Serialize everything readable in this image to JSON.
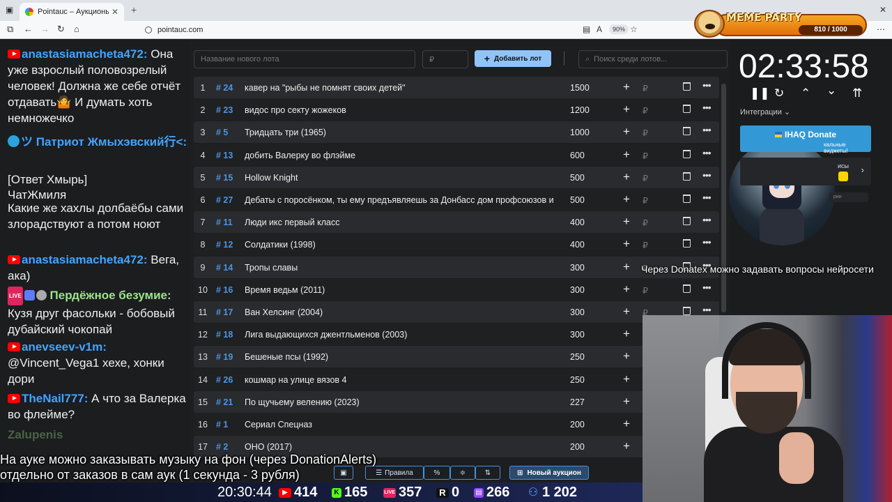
{
  "browser": {
    "tab_title": "Pointauc – Аукционы, лотереи",
    "tab_close": "✕",
    "new_tab": "+",
    "url": "pointauc.com",
    "zoom": "90%"
  },
  "meme_banner": {
    "title": "MEME PARTY",
    "count": "810 / 1000"
  },
  "chat": {
    "messages": [
      {
        "user": "anastasiamacheta472:",
        "text": " Она уже взрослый половозрелый человек! Должна же себе отчёт отдавать🤷 И думать хоть немножечко"
      },
      {
        "user": "ツ Патриот Жмыхэвский行<:",
        "text": ""
      },
      {
        "reply": "[Ответ Хмырь]"
      },
      {
        "reply2": "ЧатЖмиля"
      },
      {
        "text": "Какие же хахлы долбаёбы сами злорадствуют а потом ноют"
      },
      {
        "user": "anastasiamacheta472:",
        "text": " Вега, ака)"
      },
      {
        "user": "Пердёжное безумие:",
        "text": " Кузя друг фасольки - бобовый дубайский чокопай"
      },
      {
        "user": "anevseev-v1m:",
        "text": " @Vincent_Vega1 хехе, хонки дори"
      },
      {
        "user": "TheNail777:",
        "text": " А что за Валерка во флейме?"
      },
      {
        "user": "Zalupenis",
        "text": ""
      }
    ],
    "live_badge": "LIVE"
  },
  "auction": {
    "new_lot_placeholder": "Название нового лота",
    "amount_placeholder": "₽",
    "add_button": "Добавить лот",
    "search_placeholder": "Поиск среди лотов...",
    "lots": [
      {
        "n": "1",
        "id": "# 24",
        "name": "кавер на \"рыбы не помнят своих детей\"",
        "amount": "1500"
      },
      {
        "n": "2",
        "id": "# 23",
        "name": "видос про секту жожеков",
        "amount": "1200"
      },
      {
        "n": "3",
        "id": "# 5",
        "name": "Тридцать три (1965)",
        "amount": "1000"
      },
      {
        "n": "4",
        "id": "# 13",
        "name": "добить Валерку во флэйме",
        "amount": "600"
      },
      {
        "n": "5",
        "id": "# 15",
        "name": "Hollow Knight",
        "amount": "500"
      },
      {
        "n": "6",
        "id": "# 27",
        "name": "Дебаты с поросёнком, ты ему предъявляешь за Донбасс дом профсоюзов и",
        "amount": "500"
      },
      {
        "n": "7",
        "id": "# 11",
        "name": "Люди икс первый класс",
        "amount": "400"
      },
      {
        "n": "8",
        "id": "# 12",
        "name": "Солдатики (1998)",
        "amount": "400"
      },
      {
        "n": "9",
        "id": "# 14",
        "name": "Тропы славы",
        "amount": "300"
      },
      {
        "n": "10",
        "id": "# 16",
        "name": "Время ведьм (2011)",
        "amount": "300"
      },
      {
        "n": "11",
        "id": "# 17",
        "name": "Ван Хелсинг (2004)",
        "amount": "300"
      },
      {
        "n": "12",
        "id": "# 18",
        "name": "Лига выдающихся джентльменов (2003)",
        "amount": "300"
      },
      {
        "n": "13",
        "id": "# 19",
        "name": "Бешеные псы (1992)",
        "amount": "250"
      },
      {
        "n": "14",
        "id": "# 26",
        "name": "кошмар на улице вязов 4",
        "amount": "250"
      },
      {
        "n": "15",
        "id": "# 21",
        "name": "По щучьему велению (2023)",
        "amount": "227"
      },
      {
        "n": "16",
        "id": "# 1",
        "name": "Сериал Спецназ",
        "amount": "200"
      },
      {
        "n": "17",
        "id": "# 2",
        "name": "ОНО (2017)",
        "amount": "200"
      }
    ],
    "rub": "₽",
    "rules_button": "Правила",
    "percent_button": "%",
    "new_auction_button": "Новый аукцион"
  },
  "timer": {
    "value": "02:33:58",
    "integrations_label": "Интеграции",
    "ihaq_title": "IHAQ Donate",
    "ihaq_sub": "кальные виджеты!",
    "card_text": "исы",
    "card_small": "рии"
  },
  "overlay": {
    "donatex_note": "Через Donatex можно задавать вопросы нейросети",
    "subtitle_line1": "На ауке можно заказывать музыку на фон (через DonationAlerts)",
    "subtitle_line2": "отдельно от заказов в сам аук (1 секунда - 3 рубля)"
  },
  "stats": {
    "time": "20:30:44",
    "youtube": "414",
    "kick": "165",
    "vk": "357",
    "rutube": "0",
    "twitch": "266",
    "total": "1 202",
    "vk_badge": "LIVE",
    "rutube_badge": "R"
  },
  "colors": {
    "accent": "#90c4f8",
    "lot_id": "#4e94e0",
    "youtube": "#ff0000",
    "kick": "#53fc18"
  }
}
